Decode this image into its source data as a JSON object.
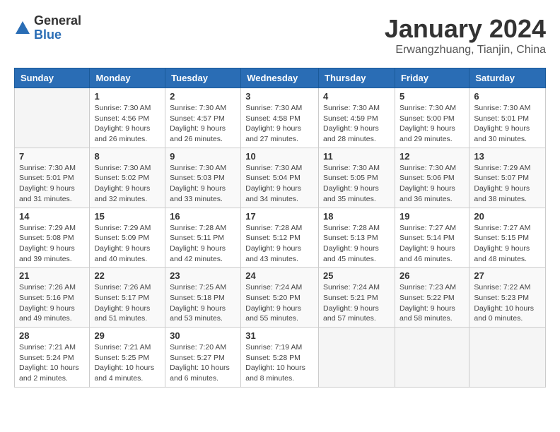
{
  "logo": {
    "general": "General",
    "blue": "Blue"
  },
  "title": "January 2024",
  "location": "Erwangzhuang, Tianjin, China",
  "days_of_week": [
    "Sunday",
    "Monday",
    "Tuesday",
    "Wednesday",
    "Thursday",
    "Friday",
    "Saturday"
  ],
  "weeks": [
    [
      {
        "day": "",
        "sunrise": "",
        "sunset": "",
        "daylight": ""
      },
      {
        "day": "1",
        "sunrise": "Sunrise: 7:30 AM",
        "sunset": "Sunset: 4:56 PM",
        "daylight": "Daylight: 9 hours and 26 minutes."
      },
      {
        "day": "2",
        "sunrise": "Sunrise: 7:30 AM",
        "sunset": "Sunset: 4:57 PM",
        "daylight": "Daylight: 9 hours and 26 minutes."
      },
      {
        "day": "3",
        "sunrise": "Sunrise: 7:30 AM",
        "sunset": "Sunset: 4:58 PM",
        "daylight": "Daylight: 9 hours and 27 minutes."
      },
      {
        "day": "4",
        "sunrise": "Sunrise: 7:30 AM",
        "sunset": "Sunset: 4:59 PM",
        "daylight": "Daylight: 9 hours and 28 minutes."
      },
      {
        "day": "5",
        "sunrise": "Sunrise: 7:30 AM",
        "sunset": "Sunset: 5:00 PM",
        "daylight": "Daylight: 9 hours and 29 minutes."
      },
      {
        "day": "6",
        "sunrise": "Sunrise: 7:30 AM",
        "sunset": "Sunset: 5:01 PM",
        "daylight": "Daylight: 9 hours and 30 minutes."
      }
    ],
    [
      {
        "day": "7",
        "sunrise": "Sunrise: 7:30 AM",
        "sunset": "Sunset: 5:01 PM",
        "daylight": "Daylight: 9 hours and 31 minutes."
      },
      {
        "day": "8",
        "sunrise": "Sunrise: 7:30 AM",
        "sunset": "Sunset: 5:02 PM",
        "daylight": "Daylight: 9 hours and 32 minutes."
      },
      {
        "day": "9",
        "sunrise": "Sunrise: 7:30 AM",
        "sunset": "Sunset: 5:03 PM",
        "daylight": "Daylight: 9 hours and 33 minutes."
      },
      {
        "day": "10",
        "sunrise": "Sunrise: 7:30 AM",
        "sunset": "Sunset: 5:04 PM",
        "daylight": "Daylight: 9 hours and 34 minutes."
      },
      {
        "day": "11",
        "sunrise": "Sunrise: 7:30 AM",
        "sunset": "Sunset: 5:05 PM",
        "daylight": "Daylight: 9 hours and 35 minutes."
      },
      {
        "day": "12",
        "sunrise": "Sunrise: 7:30 AM",
        "sunset": "Sunset: 5:06 PM",
        "daylight": "Daylight: 9 hours and 36 minutes."
      },
      {
        "day": "13",
        "sunrise": "Sunrise: 7:29 AM",
        "sunset": "Sunset: 5:07 PM",
        "daylight": "Daylight: 9 hours and 38 minutes."
      }
    ],
    [
      {
        "day": "14",
        "sunrise": "Sunrise: 7:29 AM",
        "sunset": "Sunset: 5:08 PM",
        "daylight": "Daylight: 9 hours and 39 minutes."
      },
      {
        "day": "15",
        "sunrise": "Sunrise: 7:29 AM",
        "sunset": "Sunset: 5:09 PM",
        "daylight": "Daylight: 9 hours and 40 minutes."
      },
      {
        "day": "16",
        "sunrise": "Sunrise: 7:28 AM",
        "sunset": "Sunset: 5:11 PM",
        "daylight": "Daylight: 9 hours and 42 minutes."
      },
      {
        "day": "17",
        "sunrise": "Sunrise: 7:28 AM",
        "sunset": "Sunset: 5:12 PM",
        "daylight": "Daylight: 9 hours and 43 minutes."
      },
      {
        "day": "18",
        "sunrise": "Sunrise: 7:28 AM",
        "sunset": "Sunset: 5:13 PM",
        "daylight": "Daylight: 9 hours and 45 minutes."
      },
      {
        "day": "19",
        "sunrise": "Sunrise: 7:27 AM",
        "sunset": "Sunset: 5:14 PM",
        "daylight": "Daylight: 9 hours and 46 minutes."
      },
      {
        "day": "20",
        "sunrise": "Sunrise: 7:27 AM",
        "sunset": "Sunset: 5:15 PM",
        "daylight": "Daylight: 9 hours and 48 minutes."
      }
    ],
    [
      {
        "day": "21",
        "sunrise": "Sunrise: 7:26 AM",
        "sunset": "Sunset: 5:16 PM",
        "daylight": "Daylight: 9 hours and 49 minutes."
      },
      {
        "day": "22",
        "sunrise": "Sunrise: 7:26 AM",
        "sunset": "Sunset: 5:17 PM",
        "daylight": "Daylight: 9 hours and 51 minutes."
      },
      {
        "day": "23",
        "sunrise": "Sunrise: 7:25 AM",
        "sunset": "Sunset: 5:18 PM",
        "daylight": "Daylight: 9 hours and 53 minutes."
      },
      {
        "day": "24",
        "sunrise": "Sunrise: 7:24 AM",
        "sunset": "Sunset: 5:20 PM",
        "daylight": "Daylight: 9 hours and 55 minutes."
      },
      {
        "day": "25",
        "sunrise": "Sunrise: 7:24 AM",
        "sunset": "Sunset: 5:21 PM",
        "daylight": "Daylight: 9 hours and 57 minutes."
      },
      {
        "day": "26",
        "sunrise": "Sunrise: 7:23 AM",
        "sunset": "Sunset: 5:22 PM",
        "daylight": "Daylight: 9 hours and 58 minutes."
      },
      {
        "day": "27",
        "sunrise": "Sunrise: 7:22 AM",
        "sunset": "Sunset: 5:23 PM",
        "daylight": "Daylight: 10 hours and 0 minutes."
      }
    ],
    [
      {
        "day": "28",
        "sunrise": "Sunrise: 7:21 AM",
        "sunset": "Sunset: 5:24 PM",
        "daylight": "Daylight: 10 hours and 2 minutes."
      },
      {
        "day": "29",
        "sunrise": "Sunrise: 7:21 AM",
        "sunset": "Sunset: 5:25 PM",
        "daylight": "Daylight: 10 hours and 4 minutes."
      },
      {
        "day": "30",
        "sunrise": "Sunrise: 7:20 AM",
        "sunset": "Sunset: 5:27 PM",
        "daylight": "Daylight: 10 hours and 6 minutes."
      },
      {
        "day": "31",
        "sunrise": "Sunrise: 7:19 AM",
        "sunset": "Sunset: 5:28 PM",
        "daylight": "Daylight: 10 hours and 8 minutes."
      },
      {
        "day": "",
        "sunrise": "",
        "sunset": "",
        "daylight": ""
      },
      {
        "day": "",
        "sunrise": "",
        "sunset": "",
        "daylight": ""
      },
      {
        "day": "",
        "sunrise": "",
        "sunset": "",
        "daylight": ""
      }
    ]
  ]
}
